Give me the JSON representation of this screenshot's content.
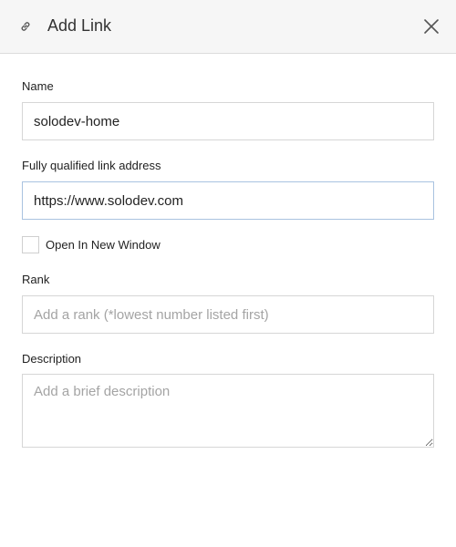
{
  "header": {
    "title": "Add Link",
    "link_icon": "link-icon",
    "close_icon": "close-icon"
  },
  "form": {
    "name": {
      "label": "Name",
      "value": "solodev-home"
    },
    "address": {
      "label": "Fully qualified link address",
      "value": "https://www.solodev.com"
    },
    "new_window": {
      "label": "Open In New Window",
      "checked": false
    },
    "rank": {
      "label": "Rank",
      "value": "",
      "placeholder": "Add a rank (*lowest number listed first)"
    },
    "description": {
      "label": "Description",
      "value": "",
      "placeholder": "Add a brief description"
    }
  },
  "colors": {
    "header_bg": "#f6f6f6",
    "border": "#d6d6d6",
    "focus_border": "#a9c3e0",
    "placeholder": "#a4a4a4"
  }
}
